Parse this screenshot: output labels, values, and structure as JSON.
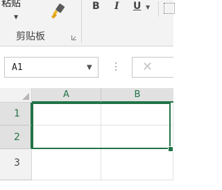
{
  "ribbon": {
    "paste_label": "粘贴",
    "bold_label": "B",
    "italic_label": "I",
    "underline_label": "U",
    "clipboard_group_label": "剪贴板"
  },
  "formula_bar": {
    "name_box_value": "A1",
    "cancel_symbol": "✕"
  },
  "grid": {
    "columns": [
      "A",
      "B"
    ],
    "rows": [
      "1",
      "2",
      "3"
    ],
    "selected_range": "A1:B2",
    "accent_color": "#217346"
  }
}
